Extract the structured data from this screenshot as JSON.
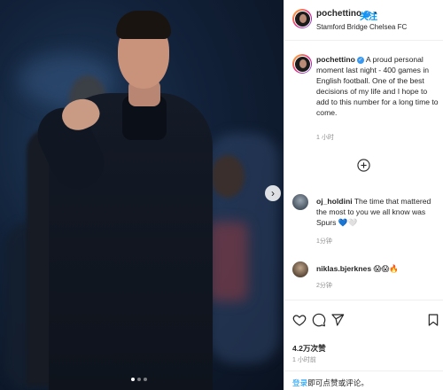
{
  "header": {
    "username": "pochettino",
    "separator": "•",
    "follow_label": "关注",
    "location": "Stamford Bridge Chelsea FC"
  },
  "caption": {
    "username": "pochettino",
    "text": "A proud personal moment last night - 400 games in English football. One of the best decisions of my life and I hope to add to this number for a long time to come.",
    "time": "1 小时"
  },
  "comments": [
    {
      "username": "oj_holdini",
      "text": "The time that mattered the most to you we all know was Spurs 💙🤍",
      "time": "1分钟"
    },
    {
      "username": "niklas.bjerknes",
      "text": "😱😱🔥",
      "time": "2分钟"
    }
  ],
  "stats": {
    "likes": "4.2万次赞",
    "post_time": "1 小时前"
  },
  "login": {
    "link_text": "登录",
    "rest_text": "即可点赞或评论。"
  },
  "carousel": {
    "slide_count": 3,
    "active_index": 0
  },
  "icons": {
    "like": "heart-icon",
    "comment": "comment-icon",
    "share": "send-icon",
    "save": "bookmark-icon",
    "add": "plus-circle-icon",
    "next": "chevron-right-icon",
    "verified": "verified-badge-icon"
  },
  "colors": {
    "link": "#0095f6",
    "verified": "#3897f0",
    "muted": "#8e8e8e"
  }
}
